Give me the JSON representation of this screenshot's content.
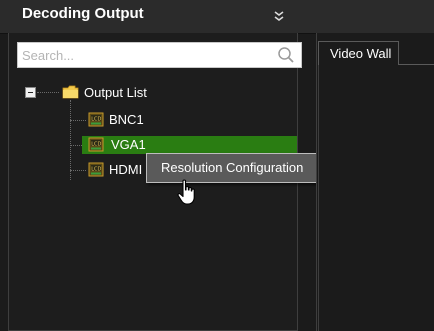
{
  "header": {
    "title": "Decoding Output"
  },
  "search": {
    "placeholder": "Search..."
  },
  "tree": {
    "root": {
      "label": "Output List"
    },
    "children": [
      {
        "label": "BNC1"
      },
      {
        "label": "VGA1"
      },
      {
        "label": "HDMI"
      }
    ]
  },
  "context_menu": {
    "items": [
      {
        "label": "Resolution Configuration"
      }
    ]
  },
  "tabs": [
    {
      "label": "Video Wall"
    }
  ],
  "colors": {
    "selected": "#2a7d12",
    "menu_bg": "#5a5a5a",
    "panel_bg": "#1b1b1b"
  }
}
